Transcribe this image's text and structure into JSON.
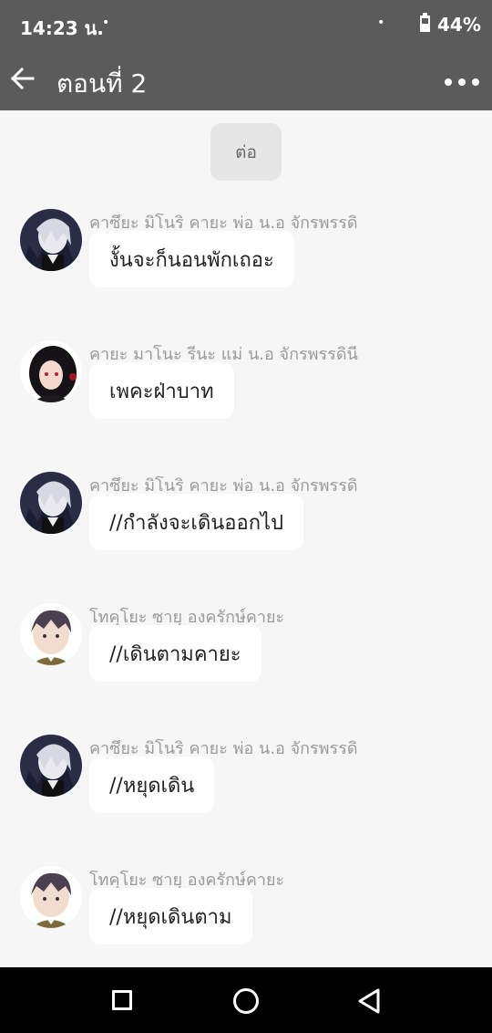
{
  "status_bar": {
    "time": "14:23 น.",
    "dot1": "•",
    "dot2": "•",
    "battery": "44%",
    "battery_level": 0.44
  },
  "app_bar": {
    "back_icon": "arrow-left-icon",
    "title": "ตอนที่ 2",
    "more_icon": "more-horizontal-icon"
  },
  "system_message": "ต่อ",
  "messages": [
    {
      "sender": "คาซึยะ มิโนริ คายะ พ่อ น.อ จักรพรรดิ",
      "text": "งั้นจะก็นอนพักเถอะ",
      "avatar": "white-hair-character-avatar"
    },
    {
      "sender": "คายะ มาโนะ รีนะ แม่ น.อ จักรพรรดินี",
      "text": "เพคะฝ่าบาท",
      "avatar": "dark-hair-woman-avatar"
    },
    {
      "sender": "คาซึยะ มิโนริ คายะ พ่อ น.อ จักรพรรดิ",
      "text": "//กำลังจะเดินออกไป",
      "avatar": "white-hair-character-avatar"
    },
    {
      "sender": "โทคุโยะ ซายุ องครักษ์คายะ",
      "text": "//เดินตามคายะ",
      "avatar": "brown-hair-boy-avatar"
    },
    {
      "sender": "คาซึยะ มิโนริ คายะ พ่อ น.อ จักรพรรดิ",
      "text": "//หยุดเดิน",
      "avatar": "white-hair-character-avatar"
    },
    {
      "sender": "โทคุโยะ ซายุ องครักษ์คายะ",
      "text": "//หยุดเดินตาม",
      "avatar": "brown-hair-boy-avatar"
    }
  ],
  "nav_bar": {
    "recent_icon": "recent-apps-square-icon",
    "home_icon": "home-circle-icon",
    "back_icon": "back-triangle-icon"
  },
  "colors": {
    "app_bar": "#5b5b5b",
    "chat_background": "#f6f6f6",
    "bubble": "#ffffff",
    "sender_text": "#9a9a9a",
    "nav_bar": "#000000"
  }
}
